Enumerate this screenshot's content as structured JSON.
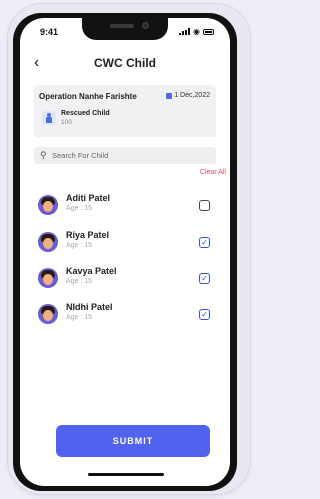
{
  "status": {
    "time": "9:41"
  },
  "header": {
    "title": "CWC Child",
    "back_icon": "chevron-left-icon"
  },
  "operation": {
    "name": "Operation Nanhe Farishte",
    "date": "1 Dec,2022",
    "rescued_label": "Rescued Child",
    "rescued_count": "100"
  },
  "search": {
    "placeholder": "Search For Child"
  },
  "actions": {
    "clear_all": "Clear All",
    "submit": "SUBMIT"
  },
  "children": [
    {
      "name": "Aditi Patel",
      "age": "Age : 15",
      "checked": false
    },
    {
      "name": "Riya Patel",
      "age": "Age : 15",
      "checked": true
    },
    {
      "name": "Kavya Patel",
      "age": "Age : 15",
      "checked": true
    },
    {
      "name": "NIdhi Patel",
      "age": "Age : 15",
      "checked": true
    }
  ],
  "colors": {
    "accent": "#5163ee",
    "clear": "#e04a6e",
    "card": "#f1f1f4"
  }
}
